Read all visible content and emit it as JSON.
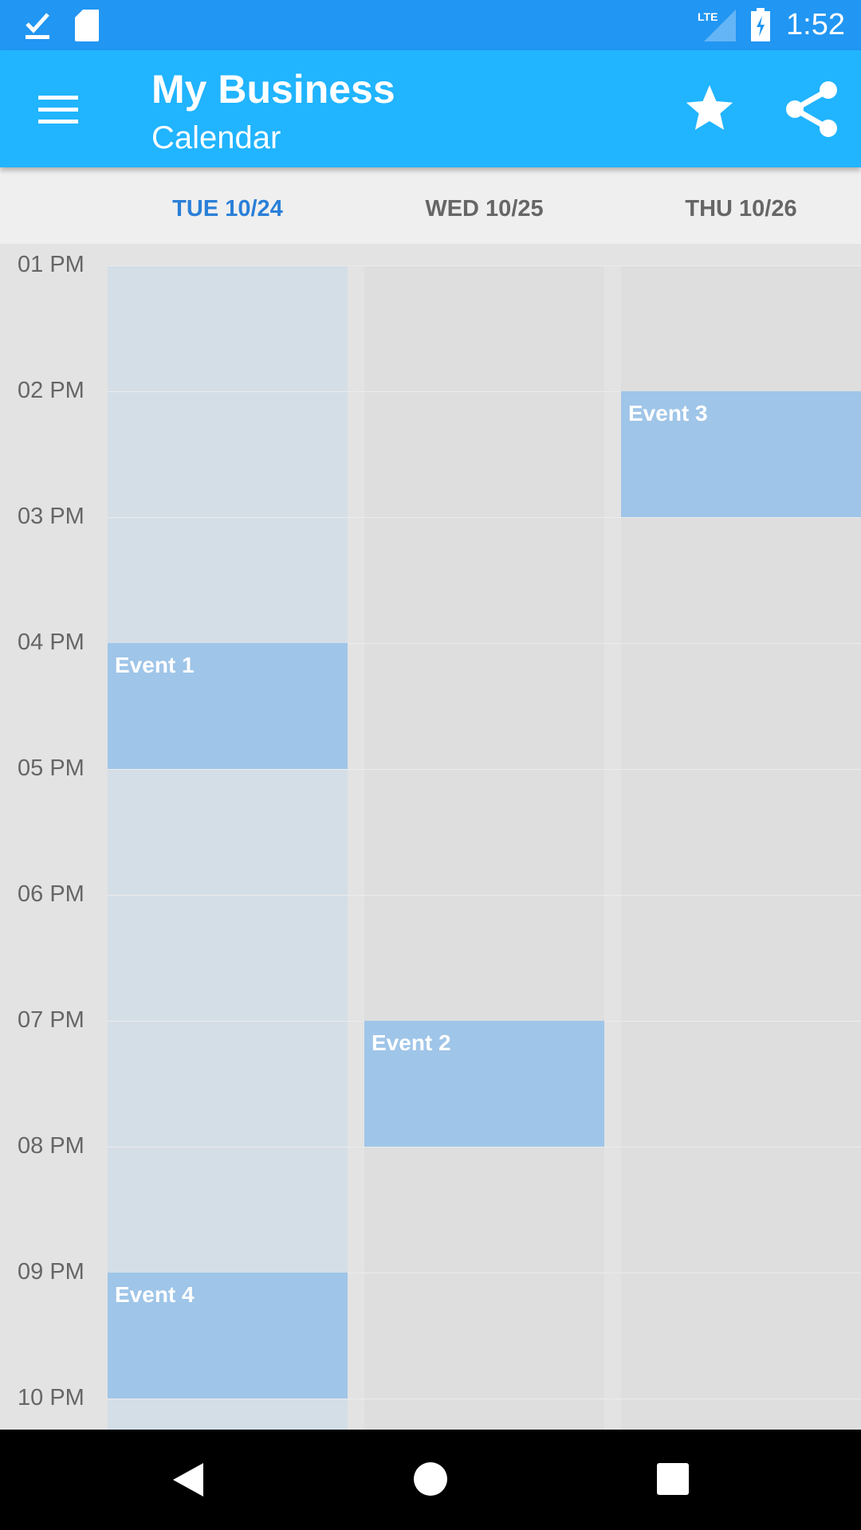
{
  "status_bar": {
    "time": "1:52",
    "icons": [
      "download-done-icon",
      "sd-card-icon",
      "lte-signal-icon",
      "battery-charging-icon"
    ]
  },
  "toolbar": {
    "title": "My Business",
    "subtitle": "Calendar",
    "icons": [
      "menu-icon",
      "star-icon",
      "share-icon"
    ]
  },
  "days": [
    {
      "label": "TUE 10/24",
      "active": true
    },
    {
      "label": "WED 10/25",
      "active": false
    },
    {
      "label": "THU 10/26",
      "active": false
    }
  ],
  "hours": [
    "01 PM",
    "02 PM",
    "03 PM",
    "04 PM",
    "05 PM",
    "06 PM",
    "07 PM",
    "08 PM",
    "09 PM",
    "10 PM"
  ],
  "events": [
    {
      "title": "Event 1",
      "day": 0,
      "start": "04 PM",
      "end": "05 PM"
    },
    {
      "title": "Event 2",
      "day": 1,
      "start": "07 PM",
      "end": "08 PM"
    },
    {
      "title": "Event 3",
      "day": 2,
      "start": "02 PM",
      "end": "03 PM"
    },
    {
      "title": "Event 4",
      "day": 0,
      "start": "09 PM",
      "end": "10 PM"
    }
  ],
  "colors": {
    "status": "#2196f3",
    "toolbar": "#21b4ff",
    "event": "#9fc5e8",
    "today_accent": "#2a7fd8"
  },
  "nav": [
    "back-icon",
    "home-icon",
    "recents-icon"
  ]
}
